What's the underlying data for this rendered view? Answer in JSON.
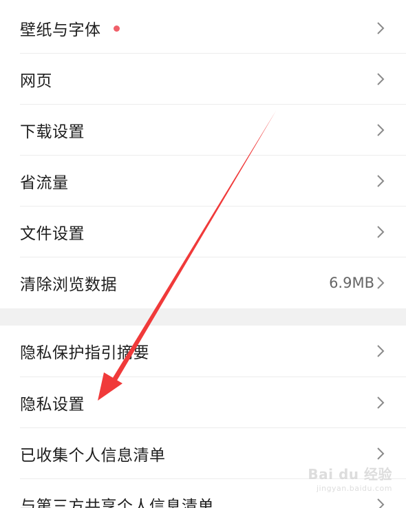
{
  "settings": {
    "items": [
      {
        "label": "壁纸与字体",
        "has_dot": true
      },
      {
        "label": "网页"
      },
      {
        "label": "下载设置"
      },
      {
        "label": "省流量"
      },
      {
        "label": "文件设置"
      },
      {
        "label": "清除浏览数据",
        "value": "6.9MB"
      },
      {
        "label": "隐私保护指引摘要"
      },
      {
        "label": "隐私设置"
      },
      {
        "label": "已收集个人信息清单"
      },
      {
        "label": "与第三方共享个人信息清单"
      }
    ]
  },
  "icons": {
    "chevron": "chevron-right-icon",
    "dot": "red-dot-badge"
  },
  "colors": {
    "text": "#1e1e1e",
    "value_text": "#666666",
    "chevron": "#8a8a8a",
    "dot": "#f0606a",
    "arrow": "#f03a3a",
    "section_gap": "#f1f1f1",
    "divider": "#ececec"
  },
  "watermark": {
    "main": "Bai du 经验",
    "sub": "jingyan.baidu.com"
  }
}
